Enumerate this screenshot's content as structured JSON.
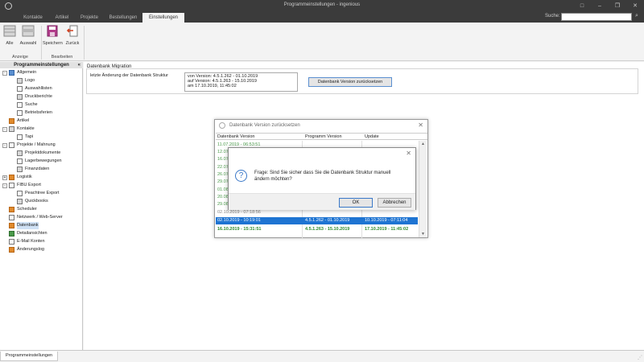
{
  "window": {
    "title": "Programmeinstellungen - ingenious",
    "minimize": "–",
    "restore": "❐",
    "close": "✕",
    "menu_icon": "□"
  },
  "tabs": [
    {
      "label": "Kontakte"
    },
    {
      "label": "Artikel"
    },
    {
      "label": "Projekte"
    },
    {
      "label": "Bestellungen"
    },
    {
      "label": "Einstellungen"
    }
  ],
  "search": {
    "label": "Suche:",
    "value": "",
    "icon": "⌕"
  },
  "ribbon": {
    "alle": "Alle",
    "auswahl": "Auswahl",
    "speichern": "Speichern",
    "zurueck": "Zurück",
    "group_anzeige": "Anzeige",
    "group_bearbeiten": "Bearbeiten"
  },
  "sidebar": {
    "title": "Programmeinstellungen",
    "collapse": "«",
    "items": [
      {
        "label": "Allgemein"
      },
      {
        "label": "Logo"
      },
      {
        "label": "Auswahllisten"
      },
      {
        "label": "Druckberichte"
      },
      {
        "label": "Suche"
      },
      {
        "label": "Betriebsferien"
      },
      {
        "label": "Artikel"
      },
      {
        "label": "Kontakte"
      },
      {
        "label": "Tapi"
      },
      {
        "label": "Projekte / Mahnung"
      },
      {
        "label": "Projektdokumente"
      },
      {
        "label": "Lagerbewegungen"
      },
      {
        "label": "Finanzdaten"
      },
      {
        "label": "Logistik"
      },
      {
        "label": "FIBU Export"
      },
      {
        "label": "Peachtree Export"
      },
      {
        "label": "Quickbooks"
      },
      {
        "label": "Scheduler"
      },
      {
        "label": "Netzwerk / Web-Server"
      },
      {
        "label": "Datenbank"
      },
      {
        "label": "Detailansichten"
      },
      {
        "label": "E-Mail Konten"
      },
      {
        "label": "Änderungslog"
      }
    ]
  },
  "migration": {
    "section_title": "Datenbank Migration",
    "label": "letzte Änderung der Datenbank Struktur",
    "info_line1": "von Version: 4.5.1.262 - 01.10.2019",
    "info_line2": "auf Version: 4.5.1.263 - 15.10.2019",
    "info_line3": "am 17.10.2019, 11:45:02",
    "reset_button": "Datenbank Version zurücksetzen"
  },
  "version_dialog": {
    "title": "Datenbank Version zurücksetzen",
    "close": "✕",
    "columns": [
      "Datenbank Version",
      "Programm Version",
      "Update"
    ],
    "rows": [
      {
        "c1": "11.07.2019 - 06:53:51",
        "c2": "",
        "c3": ""
      },
      {
        "c1": "12.07",
        "c2": "",
        "c3": ""
      },
      {
        "c1": "16.07",
        "c2": "",
        "c3": ""
      },
      {
        "c1": "22.07",
        "c2": "",
        "c3": ""
      },
      {
        "c1": "26.07",
        "c2": "",
        "c3": ""
      },
      {
        "c1": "29.07",
        "c2": "",
        "c3": ""
      },
      {
        "c1": "01.08",
        "c2": "",
        "c3": ""
      },
      {
        "c1": "20.08",
        "c2": "",
        "c3": ""
      },
      {
        "c1": "29.08",
        "c2": "",
        "c3": ""
      },
      {
        "c1": "02.10.2019 - 07:18:56",
        "c2": "",
        "c3": ""
      },
      {
        "c1": "02.10.2019 - 10:19:01",
        "c2": "4.5.1.262 - 01.10.2019",
        "c3": "10.10.2019 - 07:11:04"
      },
      {
        "c1": "16.10.2019 - 15:31:51",
        "c2": "4.5.1.263 - 15.10.2019",
        "c3": "17.10.2019 - 11:45:02"
      }
    ]
  },
  "question": {
    "close": "✕",
    "icon": "?",
    "text": "Frage: Sind Sie sicher dass Sie die Datenbank Struktur manuell ändern möchten?",
    "ok": "OK",
    "cancel": "Abbrechen"
  },
  "bottom": {
    "tab": "Programmeinstellungen",
    "grip": "⋰"
  }
}
